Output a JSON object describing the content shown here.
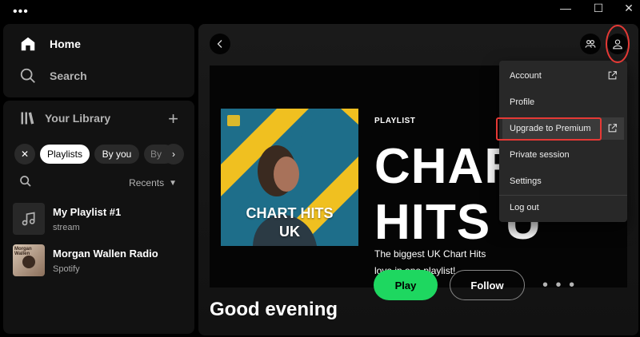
{
  "nav": {
    "home": "Home",
    "search": "Search"
  },
  "library": {
    "title": "Your Library",
    "chips": [
      "Playlists",
      "By you",
      "By"
    ],
    "sort_label": "Recents",
    "items": [
      {
        "title": "My Playlist #1",
        "subtitle": "stream"
      },
      {
        "title": "Morgan Wallen Radio",
        "subtitle": "Spotify",
        "thumb_text": "Morgan Wallen"
      }
    ]
  },
  "hero": {
    "type_label": "PLAYLIST",
    "title_line1": "CHAR",
    "title_line2": "HITS U",
    "cover_text_line1": "CHART HITS",
    "cover_text_line2": "UK",
    "description": "The biggest UK Chart Hits love in one playlist!",
    "play_label": "Play",
    "follow_label": "Follow",
    "more_label": "• • •"
  },
  "greeting": "Good evening",
  "menu": {
    "items": [
      {
        "label": "Account",
        "external": true
      },
      {
        "label": "Profile",
        "external": false
      },
      {
        "label": "Upgrade to Premium",
        "external": true
      },
      {
        "label": "Private session",
        "external": false
      },
      {
        "label": "Settings",
        "external": false
      },
      {
        "label": "Log out",
        "external": false
      }
    ]
  },
  "colors": {
    "accent_green": "#1ed760",
    "highlight_red": "#e53935",
    "panel_bg": "#121212",
    "menu_bg": "#282828"
  },
  "icons": [
    "home-icon",
    "search-icon",
    "library-icon",
    "plus-icon",
    "close-icon",
    "chevron-right-icon",
    "chevron-left-icon",
    "caret-down-icon",
    "friends-icon",
    "user-icon",
    "external-link-icon",
    "music-note-icon"
  ]
}
